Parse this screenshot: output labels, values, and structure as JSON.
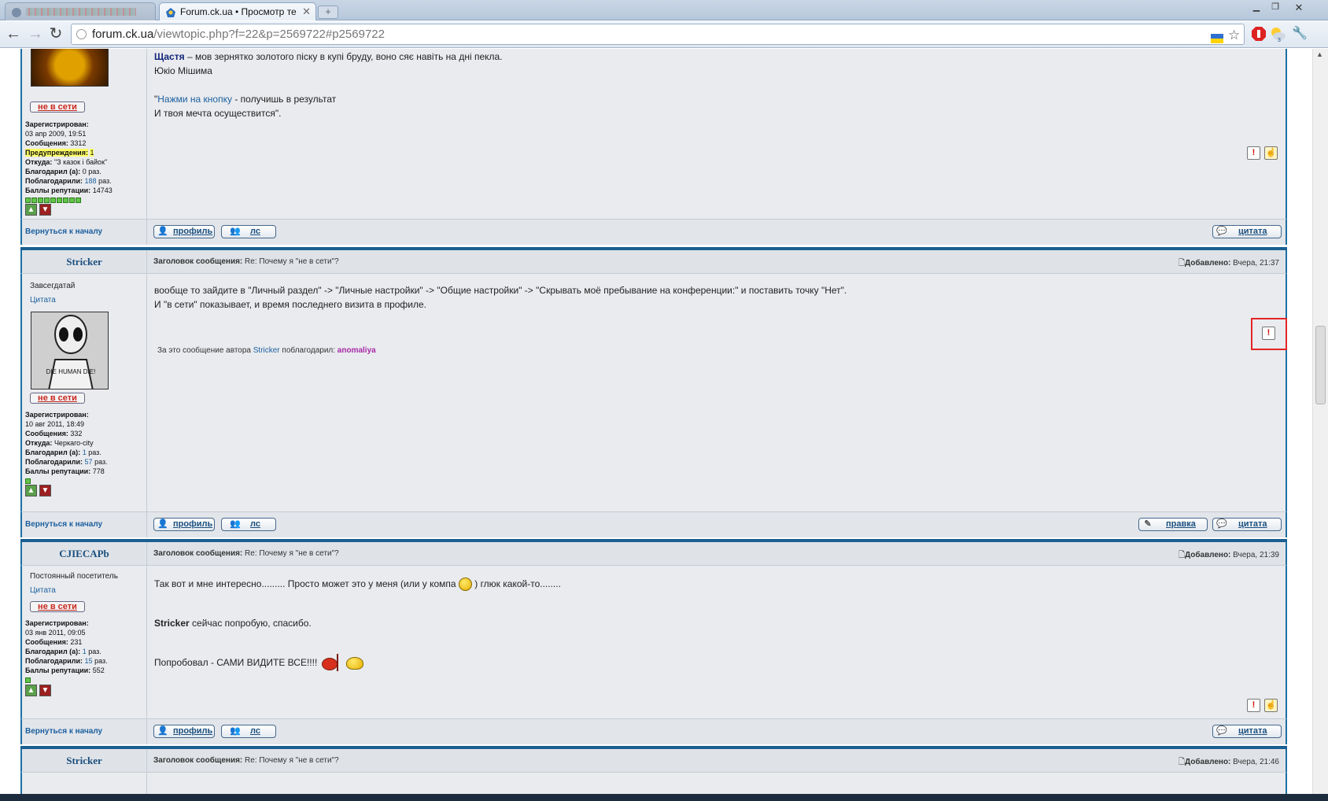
{
  "browser": {
    "tabs": [
      {
        "label": ""
      },
      {
        "label": "Forum.ck.ua • Просмотр те"
      }
    ],
    "url_host": "forum.ck.ua",
    "url_path": "/viewtopic.php?f=22&p=2569722#p2569722"
  },
  "common": {
    "offline_label": "не в сети",
    "back_to_top": "Вернуться к началу",
    "profile_btn": "профиль",
    "pm_btn": "лс",
    "quote_btn": "цитата",
    "edit_btn": "правка",
    "subject_label": "Заголовок сообщения:",
    "added_label": "Добавлено:",
    "quote_link": "Цитата"
  },
  "post1": {
    "stats": {
      "registered_label": "Зарегистрирован:",
      "registered": "03 апр 2009, 19:51",
      "messages_label": "Сообщения:",
      "messages": "3312",
      "warnings_label": "Предупреждения:",
      "warnings": "1",
      "from_label": "Откуда:",
      "from": "\"З казок і байок\"",
      "thanked_label": "Благодарил (а):",
      "thanked": "0 раз.",
      "was_thanked_label": "Поблагодарили:",
      "was_thanked_num": "188",
      "was_thanked_suffix": " раз.",
      "rep_label": "Баллы репутации:",
      "rep": "14743"
    },
    "rep_squares": 9,
    "msg": {
      "line1_bold": "Щастя",
      "line1_rest": " – мов зернятко золотого піску в купі бруду, воно сяє навіть на дні пекла.",
      "line2": "Юкіо Мішима",
      "line3_q": "\"",
      "line3_link": "Нажми на кнопку",
      "line3_rest": " - получишь в результат",
      "line4": "И твоя мечта осуществится\"."
    }
  },
  "post2": {
    "author": "Stricker",
    "subject": "Re: Почему я \"не в сети\"?",
    "added": "Вчера, 21:37",
    "rank": "Завсегдатай",
    "avatar_text": "DIE HUMAN DIE!",
    "stats": {
      "registered_label": "Зарегистрирован:",
      "registered": "10 авг 2011, 18:49",
      "messages_label": "Сообщения:",
      "messages": "332",
      "from_label": "Откуда:",
      "from": "Черкаго-city",
      "thanked_label": "Благодарил (а):",
      "thanked_num": "1",
      "thanked_suffix": " раз.",
      "was_thanked_label": "Поблагодарили:",
      "was_thanked_num": "57",
      "was_thanked_suffix": " раз.",
      "rep_label": "Баллы репутации:",
      "rep": "778"
    },
    "rep_squares": 1,
    "msg": {
      "line1": "вообще то зайдите в \"Личный раздел\" -> \"Личные настройки\" -> \"Общие настройки\" -> \"Скрывать моё пребывание на конференции:\" и поставить точку \"Нет\".",
      "line2": "И \"в сети\" показывает, и время последнего визита в профиле."
    },
    "thanks": {
      "prefix": "За это сообщение автора ",
      "author": "Stricker",
      "middle": " поблагодарил: ",
      "who": "anomaliya"
    }
  },
  "post3": {
    "author": "CJIECAPb",
    "subject": "Re: Почему я \"не в сети\"?",
    "added": "Вчера, 21:39",
    "rank": "Постоянный посетитель",
    "stats": {
      "registered_label": "Зарегистрирован:",
      "registered": "03 янв 2011, 09:05",
      "messages_label": "Сообщения:",
      "messages": "231",
      "thanked_label": "Благодарил (а):",
      "thanked_num": "1",
      "thanked_suffix": " раз.",
      "was_thanked_label": "Поблагодарили:",
      "was_thanked_num": "15",
      "was_thanked_suffix": " раз.",
      "rep_label": "Баллы репутации:",
      "rep": "552"
    },
    "rep_squares": 1,
    "msg": {
      "line1a": "Так вот и мне интересно......... Просто может это у меня (или у компа ",
      "line1b": " ) глюк какой-то........",
      "line2_bold": "Stricker",
      "line2_rest": " сейчас попробую, спасибо.",
      "line3": "Попробовал - САМИ ВИДИТЕ ВСЕ!!!! "
    }
  },
  "post4": {
    "author": "Stricker",
    "subject": "Re: Почему я \"не в сети\"?",
    "added": "Вчера, 21:46"
  }
}
